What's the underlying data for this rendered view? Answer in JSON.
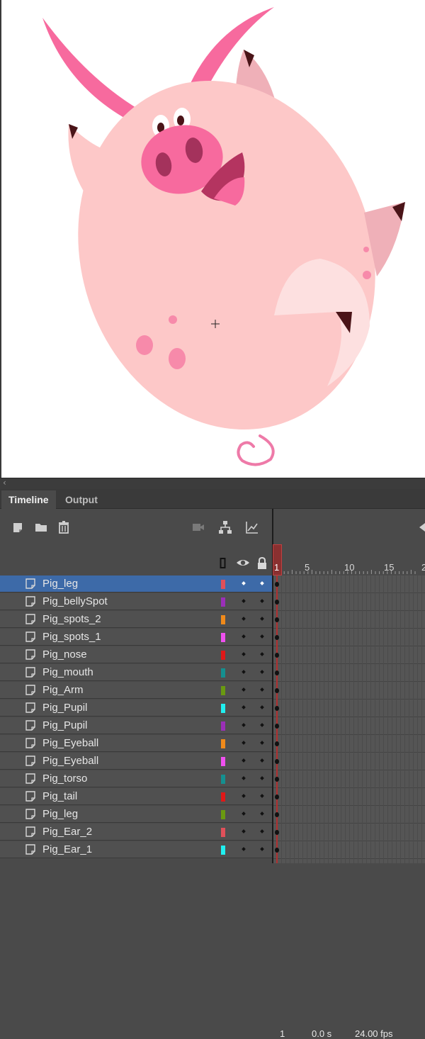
{
  "panel_tabs": [
    {
      "label": "Timeline",
      "active": true
    },
    {
      "label": "Output",
      "active": false
    }
  ],
  "toolbar": {
    "icons": [
      "new-layer-icon",
      "new-folder-icon",
      "delete-icon",
      "camera-icon",
      "layer-parenting-icon",
      "graph-icon",
      "play-back-icon"
    ],
    "current_frame": "1",
    "time": "0.0 s",
    "fps": "24.00 fps"
  },
  "column_header_icons": [
    "outline-icon",
    "eye-icon",
    "lock-icon"
  ],
  "ruler": {
    "labels": [
      "1",
      "5",
      "10",
      "15",
      "2"
    ]
  },
  "layers": [
    {
      "name": "Pig_leg",
      "color": "#e0505a",
      "selected": true
    },
    {
      "name": "Pig_bellySpot",
      "color": "#9b2fb8"
    },
    {
      "name": "Pig_spots_2",
      "color": "#f08a1a"
    },
    {
      "name": "Pig_spots_1",
      "color": "#f050f0"
    },
    {
      "name": "Pig_nose",
      "color": "#e01818"
    },
    {
      "name": "Pig_mouth",
      "color": "#149090"
    },
    {
      "name": "Pig_Arm",
      "color": "#6a9a10"
    },
    {
      "name": "Pig_Pupil",
      "color": "#20f0f0"
    },
    {
      "name": "Pig_Pupil",
      "color": "#9b2fb8"
    },
    {
      "name": "Pig_Eyeball",
      "color": "#f08a1a"
    },
    {
      "name": "Pig_Eyeball",
      "color": "#f050f0"
    },
    {
      "name": "Pig_torso",
      "color": "#149090"
    },
    {
      "name": "Pig_tail",
      "color": "#e01818"
    },
    {
      "name": "Pig_leg",
      "color": "#6a9a10"
    },
    {
      "name": "Pig_Ear_2",
      "color": "#e0505a"
    },
    {
      "name": "Pig_Ear_1",
      "color": "#20f0f0"
    }
  ],
  "colors": {
    "pig_body": "#fdc8c8",
    "pig_pink": "#f76a9e",
    "pig_dark": "#4a1418",
    "selection_blue": "#3d6aa8",
    "playhead_red": "#b03030"
  }
}
